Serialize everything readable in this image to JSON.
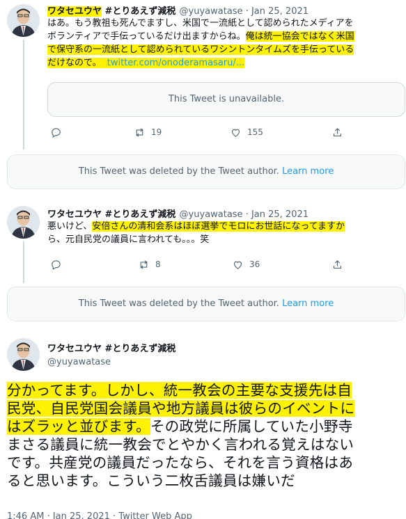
{
  "tweet1": {
    "author_name": "ワタセユウヤ",
    "author_tag": " #とりあえず減税",
    "handle_date": "@yuyawatase · Jan 25, 2021",
    "text_line1": "はあ。もう教祖も死んでますし、米国で一流紙として認められたメディアを",
    "text_line2a": "ボランティアで手伝っているだけ出ますからね。",
    "text_line2b": "俺は統一協会ではなく米国",
    "text_line3": "で保守系の一流紙として認められているワシントンタイムズを手伝っている",
    "text_line4": "だけなので。",
    "link": "twitter.com/onoderamasaru/...",
    "quote_text": "This Tweet is unavailable.",
    "retweets": "19",
    "likes": "155"
  },
  "deleted1": {
    "text": "This Tweet was deleted by the Tweet author. ",
    "learn_more": "Learn more"
  },
  "tweet2": {
    "author_name": "ワタセユウヤ",
    "author_tag": " #とりあえず減税",
    "handle_date": "@yuyawatase · Jan 25, 2021",
    "text_line1a": "悪いけど、",
    "text_line1b": "安倍さんの清和会系はほぼ選挙でモロにお世話になってますか",
    "text_line2": "ら、元自民党の議員に言われても。。。笑",
    "retweets": "8",
    "likes": "36"
  },
  "deleted2": {
    "text": "This Tweet was deleted by the Tweet author. ",
    "learn_more": "Learn more"
  },
  "main_tweet": {
    "author_name": "ワタセユウヤ #とりあえず減税",
    "handle": "@yuyawatase",
    "line1": "分かってます。しかし、統一教会の主要な支援先は自",
    "line2": "民党、自民党国会議員や地方議員は彼らのイベントに",
    "line3a": "はズラッと並びます。",
    "line3b": "その政党に所属していた小野寺",
    "line4": "まさる議員に統一教会でとやかく言われる覚えはない",
    "line5": "です。共産党の議員だったなら、それを言う資格はあ",
    "line6": "ると思います。こういう二枚舌議員は嫌いだ",
    "timestamp": "1:46 AM · Jan 25, 2021 · Twitter Web App"
  },
  "colors": {
    "highlight": "#fff200",
    "link": "#1d9bf0",
    "muted": "#536471"
  }
}
